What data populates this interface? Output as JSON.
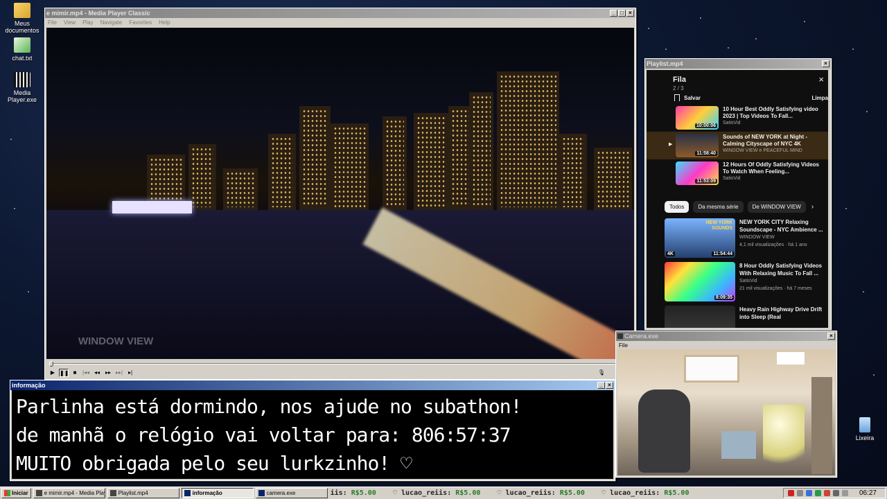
{
  "desktop": {
    "icons": [
      {
        "label": "Meus documentos",
        "icon": "folder-icon"
      },
      {
        "label": "chat.txt",
        "icon": "text-file-icon"
      },
      {
        "label": "Media Player.exe",
        "icon": "media-player-icon"
      },
      {
        "label": "Lixeira",
        "icon": "recycle-bin-icon"
      }
    ]
  },
  "player": {
    "title": "e mimir.mp4 - Media Player Classic",
    "menu": [
      "File",
      "View",
      "Play",
      "Navigate",
      "Favorites",
      "Help"
    ],
    "watermark": "WINDOW VIEW",
    "seek_progress": 0
  },
  "playlist": {
    "title": "Playlist.mp4",
    "queue_title": "Fila",
    "queue_position": "2 / 3",
    "save_label": "Salvar",
    "clear_label": "Limpa",
    "queue": [
      {
        "title": "10 Hour Best Oddly Satisfying video 2023 | Top Videos To Fall...",
        "channel": "SatisVid",
        "duration": "10:00:06"
      },
      {
        "title": "Sounds of NEW YORK at Night - Calming Cityscape of NYC 4K",
        "channel": "WINDOW VIEW e PEACEFUL MIND",
        "duration": "11:58:40"
      },
      {
        "title": "12 Hours Of Oddly Satisfying Videos To Watch When Feeling...",
        "channel": "SatisVid",
        "duration": "11:53:09"
      }
    ],
    "chips": [
      "Todos",
      "Da mesma série",
      "De WINDOW VIEW"
    ],
    "recommendations": [
      {
        "title": "NEW YORK CITY Relaxing Soundscape - NYC Ambience ...",
        "channel": "WINDOW VIEW",
        "meta": "4,1 mil visualizações · há 1 ano",
        "duration": "11:54:44",
        "badge": "4K",
        "thumb_text": "NEW YORK SOUNDS"
      },
      {
        "title": "8 Hour Oddly Satisfying Videos With Relaxing Music To Fall ...",
        "channel": "SatisVid",
        "meta": "21 mil visualizações · há 7 meses",
        "duration": "8:09:35"
      },
      {
        "title": "Heavy Rain Highway Drive Drift into Sleep (Real",
        "channel": "",
        "meta": "",
        "duration": ""
      }
    ]
  },
  "info": {
    "title": "informação",
    "lines": [
      "Parlinha está dormindo, nos ajude no subathon!",
      "de manhã o relógio vai voltar para:  806:57:37",
      "MUITO obrigada pelo seu lurkzinho! ♡"
    ]
  },
  "camera": {
    "title": "Camera.exe",
    "menu": "File"
  },
  "taskbar": {
    "start_label": "Iniciar",
    "tasks": [
      "e mimir.mp4 - Media Player...",
      "Playlist.mp4",
      "informação",
      "camera.exe"
    ],
    "ticker": [
      {
        "name": "iis:",
        "amount": "R$5.00"
      },
      {
        "name": "♡ lucao_reiis:",
        "amount": "R$5.00"
      },
      {
        "name": "♡ lucao_reiis:",
        "amount": "R$5.00"
      },
      {
        "name": "♡ lucao_reiis:",
        "amount": "R$5.00"
      }
    ],
    "clock": "06:27"
  }
}
